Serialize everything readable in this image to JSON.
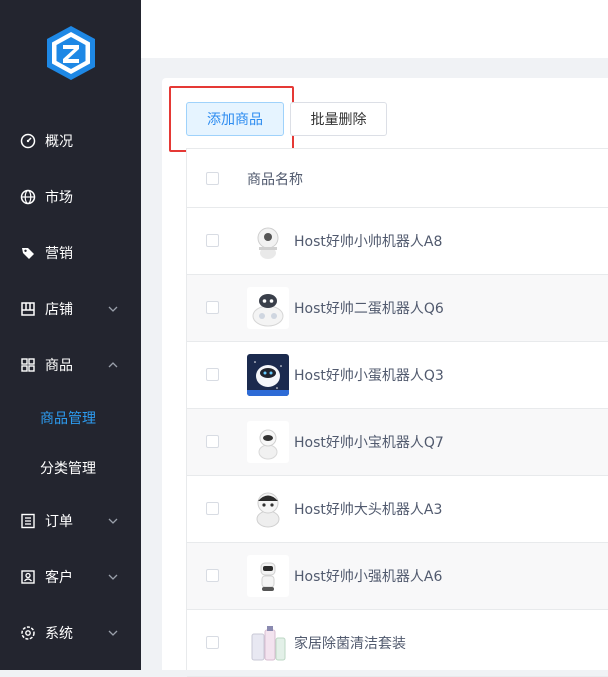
{
  "sidebar": {
    "items": [
      {
        "label": "概况",
        "icon": "dashboard-icon"
      },
      {
        "label": "市场",
        "icon": "globe-icon"
      },
      {
        "label": "营销",
        "icon": "tag-icon"
      },
      {
        "label": "店铺",
        "icon": "store-icon",
        "arrow": "chevron-down-icon"
      },
      {
        "label": "商品",
        "icon": "grid-icon",
        "arrow": "chevron-up-icon"
      },
      {
        "label": "订单",
        "icon": "order-list-icon",
        "arrow": "chevron-down-icon"
      },
      {
        "label": "客户",
        "icon": "customer-icon",
        "arrow": "chevron-down-icon"
      },
      {
        "label": "系统",
        "icon": "settings-icon",
        "arrow": "chevron-down-icon"
      }
    ],
    "sub_items": [
      {
        "label": "商品管理",
        "active": true
      },
      {
        "label": "分类管理",
        "active": false
      }
    ],
    "colors": {
      "background": "#23252f",
      "active_text": "#2d9cf0"
    }
  },
  "toolbar": {
    "add_label": "添加商品",
    "batch_delete_label": "批量删除"
  },
  "table": {
    "header": {
      "name_column": "商品名称"
    },
    "rows": [
      {
        "name": "Host好帅小帅机器人A8",
        "thumb": "robot-a8-thumbnail"
      },
      {
        "name": "Host好帅二蛋机器人Q6",
        "thumb": "robot-q6-thumbnail"
      },
      {
        "name": "Host好帅小蛋机器人Q3",
        "thumb": "robot-q3-thumbnail"
      },
      {
        "name": "Host好帅小宝机器人Q7",
        "thumb": "robot-q7-thumbnail"
      },
      {
        "name": "Host好帅大头机器人A3",
        "thumb": "robot-a3-thumbnail"
      },
      {
        "name": "Host好帅小强机器人A6",
        "thumb": "robot-a6-thumbnail"
      },
      {
        "name": "家居除菌清洁套装",
        "thumb": "cleaning-kit-thumbnail"
      }
    ]
  }
}
